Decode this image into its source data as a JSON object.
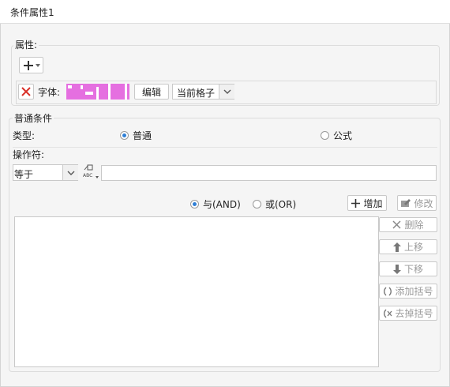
{
  "window": {
    "title": "条件属性1"
  },
  "properties": {
    "legend": "属性:",
    "font_label": "字体:",
    "edit_button": "编辑",
    "scope_select": "当前格子",
    "colors": {
      "delete_red": "#d9312a",
      "swatch": "#e56fe0"
    }
  },
  "condition": {
    "legend": "普通条件",
    "type_label": "类型:",
    "type_normal": "普通",
    "type_formula": "公式",
    "operator_label": "操作符:",
    "operator_value": "等于",
    "value_input": "",
    "logic_and": "与(AND)",
    "logic_or": "或(OR)",
    "buttons": {
      "add": "增加",
      "modify": "修改",
      "delete": "删除",
      "move_up": "上移",
      "move_down": "下移",
      "add_brackets": "添加括号",
      "remove_brackets": "去掉括号"
    }
  }
}
